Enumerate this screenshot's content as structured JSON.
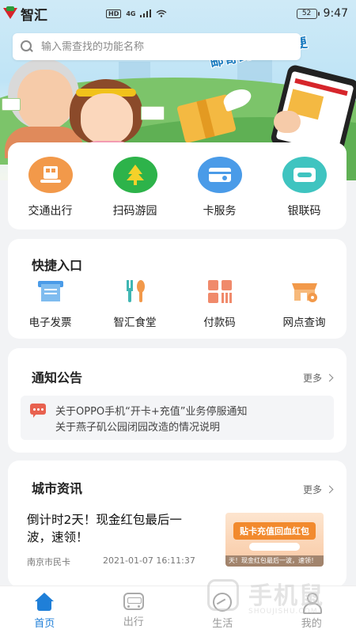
{
  "status_bar": {
    "app_name": "智汇",
    "time": "9:47",
    "battery": "52",
    "hd": "HD",
    "network": "4G"
  },
  "banner": {
    "slogan": "邮寄到家真方便"
  },
  "search": {
    "placeholder": "输入需查找的功能名称"
  },
  "services": [
    {
      "label": "交通出行",
      "icon": "bus-card-icon",
      "color": "#f2994a"
    },
    {
      "label": "扫码游园",
      "icon": "park-tree-icon",
      "color": "#2db34a"
    },
    {
      "label": "卡服务",
      "icon": "card-service-icon",
      "color": "#4a9be8"
    },
    {
      "label": "银联码",
      "icon": "unionpay-code-icon",
      "color": "#3fc4c0"
    }
  ],
  "quick_entry": {
    "title": "快捷入口",
    "items": [
      {
        "label": "电子发票",
        "icon": "e-invoice-icon"
      },
      {
        "label": "智汇食堂",
        "icon": "canteen-utensils-icon"
      },
      {
        "label": "付款码",
        "icon": "payment-code-icon"
      },
      {
        "label": "网点查询",
        "icon": "outlet-store-icon"
      }
    ]
  },
  "notice": {
    "title": "通知公告",
    "more": "更多",
    "items": [
      "关于OPPO手机“开卡+充值”业务停服通知",
      "关于燕子矶公园闭园改造的情况说明"
    ]
  },
  "news": {
    "title": "城市资讯",
    "more": "更多",
    "item": {
      "headline": "倒计时2天！现金红包最后一波，速领！",
      "source": "南京市民卡",
      "time": "2021-01-07 16:11:37",
      "thumb_title": "贴卡充值回血红包",
      "thumb_footer": "天！现金红包最后一波，速领！"
    }
  },
  "tabbar": [
    {
      "label": "首页",
      "active": true
    },
    {
      "label": "出行",
      "active": false
    },
    {
      "label": "生活",
      "active": false
    },
    {
      "label": "我的",
      "active": false
    }
  ],
  "watermark": {
    "text": "手机鼠",
    "sub": "SHOUJISHU.COM"
  },
  "colors": {
    "accent": "#1f7fd8",
    "notice_icon": "#e8614f"
  }
}
